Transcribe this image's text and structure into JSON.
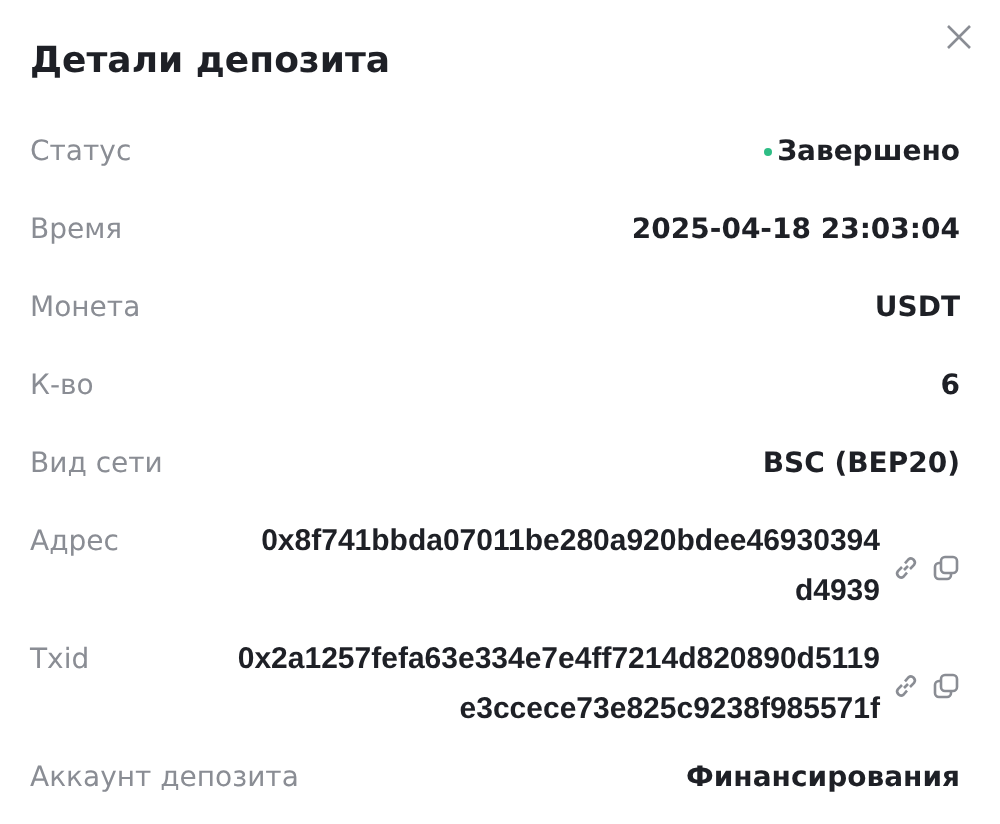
{
  "title": "Детали депозита",
  "rows": [
    {
      "kind": "status",
      "label": "Статус",
      "value": "Завершено",
      "color": "#2ebd85"
    },
    {
      "kind": "text",
      "label": "Время",
      "value": "2025-04-18 23:03:04"
    },
    {
      "kind": "text",
      "label": "Монета",
      "value": "USDT"
    },
    {
      "kind": "text",
      "label": "К-во",
      "value": "6"
    },
    {
      "kind": "text",
      "label": "Вид сети",
      "value": "BSC (BEP20)"
    },
    {
      "kind": "hash",
      "label": "Адрес",
      "lines": [
        "0x8f741bbda07011be280a920bdee46930394",
        "d4939"
      ]
    },
    {
      "kind": "hash",
      "label": "Txid",
      "lines": [
        "0x2a1257fefa63e334e7e4ff7214d820890d5119",
        "e3ccece73e825c9238f985571f"
      ]
    },
    {
      "kind": "text",
      "label": "Аккаунт депозита",
      "value": "Финансирования"
    }
  ]
}
